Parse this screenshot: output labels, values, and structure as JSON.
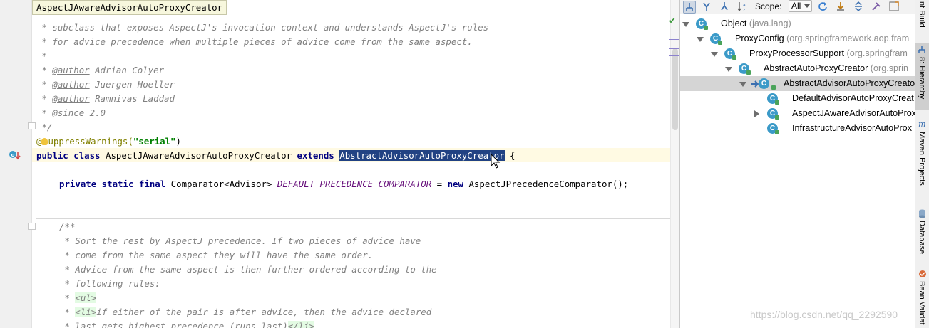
{
  "tooltip": "AspectJAwareAdvisorAutoProxyCreator",
  "code": {
    "l1": " * subclass that exposes AspectJ's invocation context and understands AspectJ's rules",
    "l2": " * for advice precedence when multiple pieces of advice come from the same aspect.",
    "l3": " *",
    "l4_tag": "@author",
    "l4_text": " Adrian Colyer",
    "l5_tag": "@author",
    "l5_text": " Juergen Hoeller",
    "l6_tag": "@author",
    "l6_text": " Ramnivas Laddad",
    "l7_tag": "@since",
    "l7_text": " 2.0",
    "l8": " */",
    "l9_anno_a": "@",
    "l9_anno_b": "uppressWarnings(",
    "l9_str": "\"serial\"",
    "l9_end": ")",
    "l10_kw1": "public class",
    "l10_name": " AspectJAwareAdvisorAutoProxyCreator ",
    "l10_kw2": "extends",
    "l10_sel": "AbstractAdvisorAutoProxyCreator",
    "l10_end": " {",
    "l11_kw": "private static final",
    "l11_type": " Comparator<Advisor> ",
    "l11_const": "DEFAULT_PRECEDENCE_COMPARATOR",
    "l11_eq": " = ",
    "l11_new": "new",
    "l11_rest": " AspectJPrecedenceComparator();",
    "l12": "/**",
    "l13": " * Sort the rest by AspectJ precedence. If two pieces of advice have",
    "l14": " * come from the same aspect they will have the same order.",
    "l15": " * Advice from the same aspect is then further ordered according to the",
    "l16": " * following rules:",
    "l17_pre": " * ",
    "l17_tag": "<ul>",
    "l18_pre": " * ",
    "l18_tag": "<li>",
    "l18_text": "if either of the pair is after advice, then the advice declared",
    "l19_pre": " * last gets highest precedence (runs last)",
    "l19_tag": "</li>"
  },
  "hierarchy": {
    "scope_label": "Scope:",
    "scope_value": "All",
    "nodes": [
      {
        "name": "Object",
        "pkg": " (java.lang)"
      },
      {
        "name": "ProxyConfig",
        "pkg": " (org.springframework.aop.fram"
      },
      {
        "name": "ProxyProcessorSupport",
        "pkg": " (org.springfram"
      },
      {
        "name": "AbstractAutoProxyCreator",
        "pkg": " (org.sprin"
      },
      {
        "name": "AbstractAdvisorAutoProxyCreato",
        "pkg": ""
      },
      {
        "name": "DefaultAdvisorAutoProxyCreat",
        "pkg": ""
      },
      {
        "name": "AspectJAwareAdvisorAutoProx",
        "pkg": ""
      },
      {
        "name": "InfrastructureAdvisorAutoProx",
        "pkg": ""
      }
    ]
  },
  "watermark": "https://blog.csdn.net/qq_2292590",
  "strip": {
    "build": "nt Build",
    "hierarchy": "8: Hierarchy",
    "maven": "Maven Projects",
    "database": "Database",
    "bean": "Bean Validat"
  },
  "colors": {
    "selection": "#214283",
    "current_line": "#fffae3",
    "keyword": "#000080",
    "string": "#008000",
    "comment": "#808080",
    "constant": "#660e7a",
    "class_icon": "#3b9ac8"
  }
}
